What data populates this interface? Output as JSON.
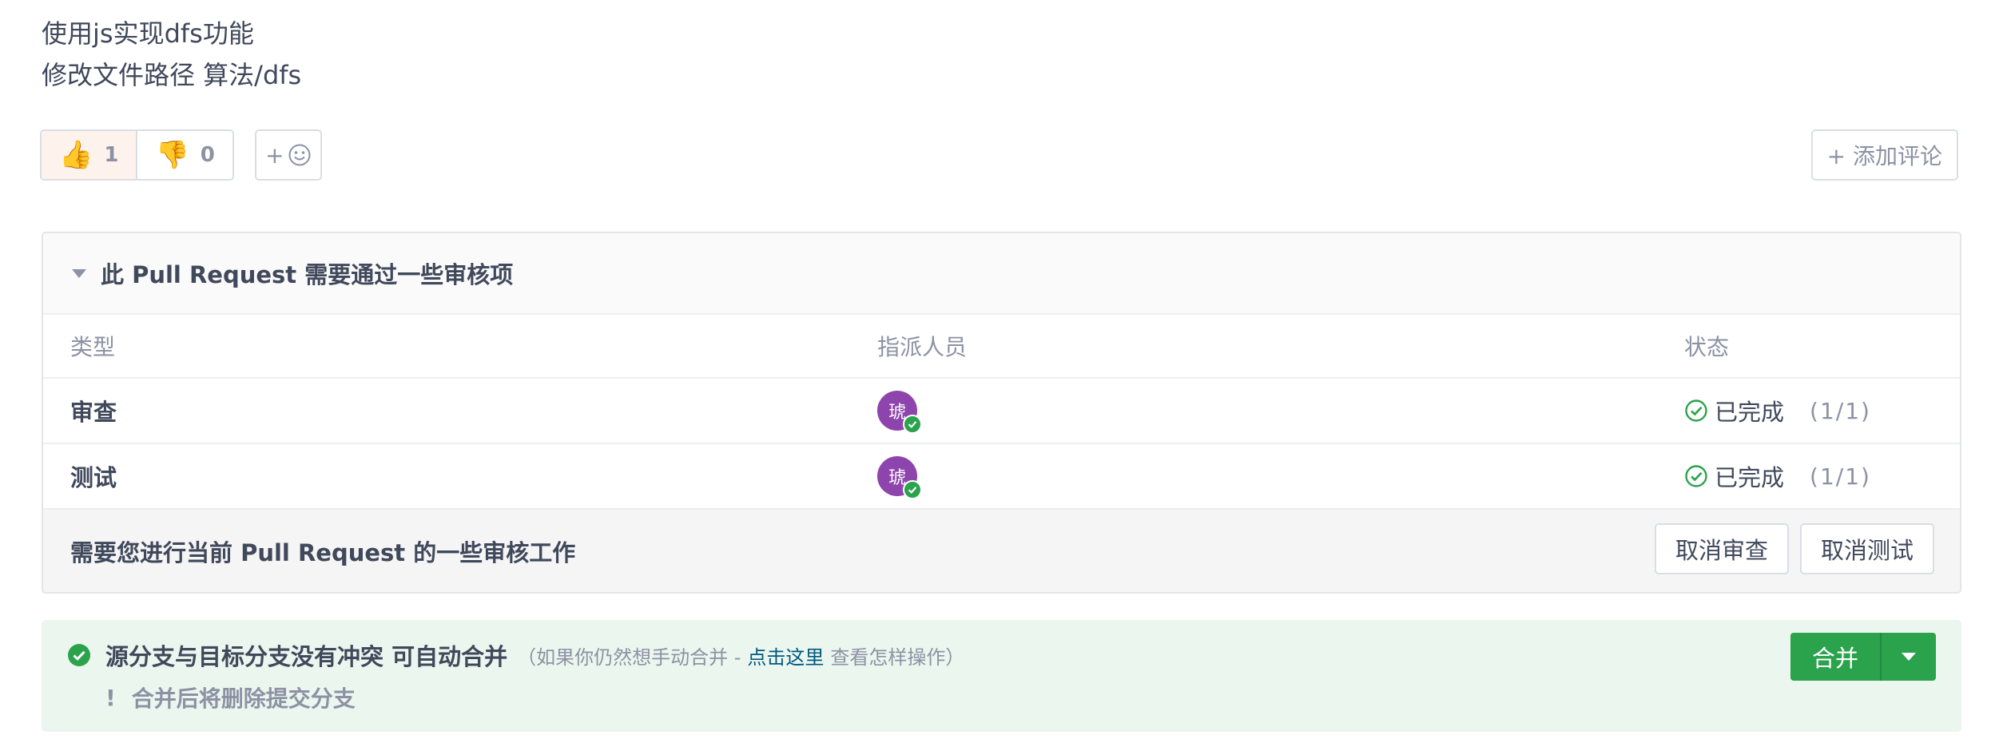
{
  "description": {
    "line1": "使用js实现dfs功能",
    "line2": "修改文件路径 算法/dfs"
  },
  "reactions": {
    "thumbs_up": {
      "emoji": "👍",
      "count": "1"
    },
    "thumbs_down": {
      "emoji": "👎",
      "count": "0"
    },
    "add_emoji": {
      "plus": "+",
      "icon": "smiley-icon"
    },
    "add_comment_label": "+ 添加评论"
  },
  "review": {
    "title": "此 Pull Request 需要通过一些审核项",
    "columns": {
      "type": "类型",
      "assignee": "指派人员",
      "status": "状态"
    },
    "rows": [
      {
        "type": "审查",
        "avatar_text": "琥",
        "status": "已完成",
        "count": "(1/1)"
      },
      {
        "type": "测试",
        "avatar_text": "琥",
        "status": "已完成",
        "count": "(1/1)"
      }
    ],
    "footer_text": "需要您进行当前 Pull Request 的一些审核工作",
    "cancel_review_label": "取消审查",
    "cancel_test_label": "取消测试"
  },
  "merge": {
    "title": "源分支与目标分支没有冲突 可自动合并",
    "hint_prefix": "（如果你仍然想手动合并 -",
    "hint_link": "点击这里",
    "hint_suffix": "查看怎样操作）",
    "note_mark": "!",
    "note": "合并后将删除提交分支",
    "merge_label": "合并"
  },
  "colors": {
    "success": "#2ba24c",
    "avatar": "#8e44ad",
    "link": "#005980",
    "merge_bg": "#ebf6ee"
  }
}
